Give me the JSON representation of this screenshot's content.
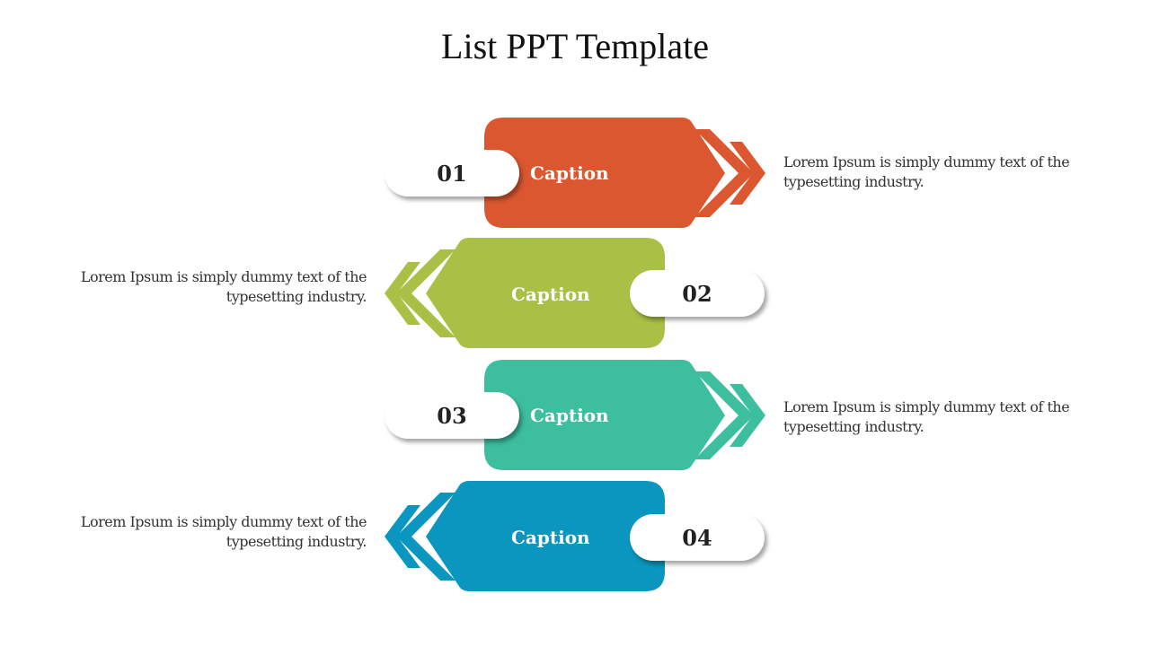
{
  "title": "List PPT Template",
  "items": [
    {
      "number": "01",
      "caption": "Caption",
      "text": "Lorem Ipsum is simply dummy text of the typesetting industry.",
      "color": "#DA5730",
      "direction": "right"
    },
    {
      "number": "02",
      "caption": "Caption",
      "text": "Lorem Ipsum is simply dummy text of the typesetting industry.",
      "color": "#A9C046",
      "direction": "left"
    },
    {
      "number": "03",
      "caption": "Caption",
      "text": "Lorem Ipsum is simply dummy text of the typesetting industry.",
      "color": "#3CBE9F",
      "direction": "right"
    },
    {
      "number": "04",
      "caption": "Caption",
      "text": "Lorem Ipsum is simply dummy text of the typesetting industry.",
      "color": "#0A96BE",
      "direction": "left"
    }
  ]
}
